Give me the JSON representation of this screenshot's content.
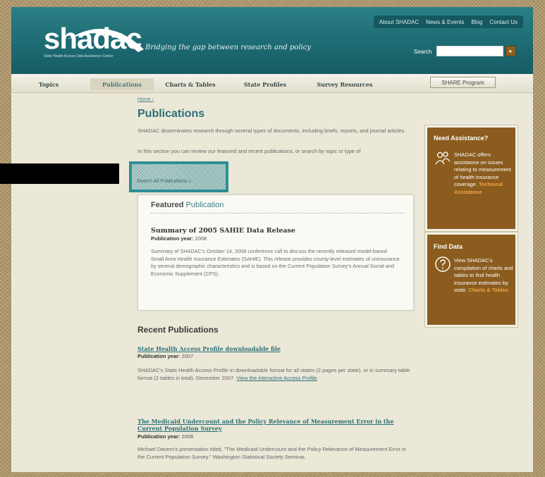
{
  "header": {
    "top_links": [
      "About SHADAC",
      "News & Events",
      "Blog",
      "Contact Us"
    ],
    "logo_text": "shadac",
    "logo_subtitle": "State Health Access Data Assistance Center",
    "tagline": "Bridging the gap between research and policy",
    "search_label": "Search",
    "search_value": "",
    "search_go": "▸"
  },
  "nav": {
    "tabs": [
      "Topics",
      "Publications",
      "Charts & Tables",
      "State Profiles",
      "Survey Resources"
    ],
    "active_tab": "Publications",
    "share_button": "SHARE Program"
  },
  "content": {
    "breadcrumb": "Home ›",
    "title": "Publications",
    "intro_1": "SHADAC disseminates research through several types of documents, including briefs, reports, and journal articles.",
    "intro_2": "In this section you can review our featured and recent publications, or search by topic or type of",
    "search_all": "Search All Publications »"
  },
  "featured": {
    "label_bold": "Featured",
    "label_rest": "Publication",
    "title": "Summary of 2005 SAHIE Data Release",
    "year_label": "Publication year:",
    "year": "2008",
    "description": "Summary of SHADAC's October 14, 2008 conference call to discuss the recently released model-based Small Area Health Insurance Estimates (SAHIE). This release provides county-level estimates of uninsurance by several demographic characteristics and is based on the Current Population Survey's Annual Social and Economic Supplement (CPS)."
  },
  "recent": {
    "title": "Recent Publications",
    "items": [
      {
        "title": "State Health Access Profile downloadable file",
        "year_label": "Publication year:",
        "year": "2007",
        "desc": "SHADAC's State Health Access Profile in downloadable format for all states (2 pages per state), or in summary table format (2 tables in total). December 2007.",
        "link": "View the interactive Access Profile",
        "link_suffix": "."
      },
      {
        "title": "The Medicaid Undercount and the Policy Relevance of Measurement Error in the Current Population Survey",
        "year_label": "Publication year:",
        "year": "2008",
        "desc": "Michael Davern's presentation titled, \"The Medicaid Undercount and the Policy Relevance of Measurement Error in the Current Population Survey.\" Washington Statistical Society Seminar,"
      }
    ]
  },
  "sidebar": {
    "assistance": {
      "title": "Need Assistance?",
      "text": "SHADAC offers assistance on issues relating to measurement of health insurance coverage.",
      "link": "Technical Assistance"
    },
    "find_data": {
      "title": "Find Data",
      "text": "View SHADAC's compilation of charts and tables to find health insurance estimates by state.",
      "link": "Charts & Tables"
    }
  },
  "colors": {
    "header_teal": "#1d6b73",
    "link_teal": "#2b6f76",
    "sidebar_brown": "#8b5c1e",
    "page_bg": "#ebe8d8"
  }
}
